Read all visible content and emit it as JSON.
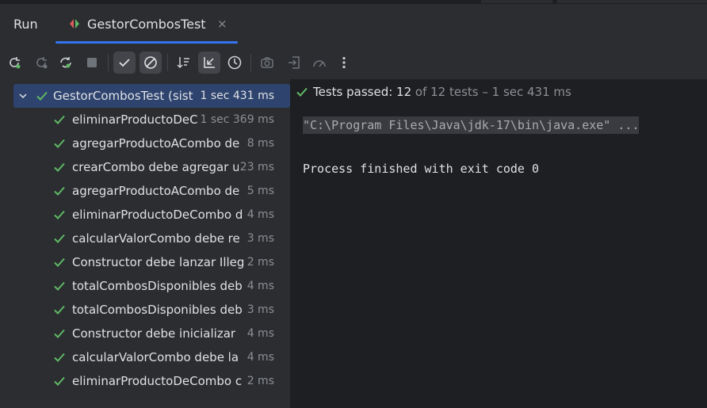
{
  "header": {
    "run_label": "Run",
    "tab_title": "GestorCombosTest",
    "tab_close": "×"
  },
  "toolbar": {
    "buttons": [
      {
        "icon": "rerun-icon",
        "active": false
      },
      {
        "icon": "rerun-failed-icon",
        "active": false
      },
      {
        "icon": "toggle-auto-test-icon",
        "active": false
      },
      {
        "icon": "stop-icon",
        "active": false
      },
      {
        "icon": "show-passed-icon",
        "active": true
      },
      {
        "icon": "show-ignored-icon",
        "active": true
      },
      {
        "icon": "sort-icon",
        "active": false
      },
      {
        "icon": "collapse-icon",
        "active": true
      },
      {
        "icon": "history-icon",
        "active": false
      },
      {
        "icon": "screenshot-icon",
        "active": false
      },
      {
        "icon": "import-tests-icon",
        "active": false
      },
      {
        "icon": "coverage-icon",
        "active": false
      },
      {
        "icon": "more-icon",
        "active": false
      }
    ]
  },
  "tree": {
    "root": {
      "label": "GestorCombosTest (sist",
      "duration": "1 sec 431 ms"
    },
    "items": [
      {
        "label": "eliminarProductoDeC",
        "duration": "1 sec 369 ms"
      },
      {
        "label": "agregarProductoACombo de",
        "duration": "8 ms"
      },
      {
        "label": "crearCombo debe agregar u",
        "duration": "23 ms"
      },
      {
        "label": "agregarProductoACombo de",
        "duration": "5 ms"
      },
      {
        "label": "eliminarProductoDeCombo d",
        "duration": "4 ms"
      },
      {
        "label": "calcularValorCombo debe re",
        "duration": "3 ms"
      },
      {
        "label": "Constructor debe lanzar Illeg",
        "duration": "2 ms"
      },
      {
        "label": "totalCombosDisponibles deb",
        "duration": "4 ms"
      },
      {
        "label": "totalCombosDisponibles deb",
        "duration": "3 ms"
      },
      {
        "label": "Constructor debe inicializar",
        "duration": "4 ms"
      },
      {
        "label": "calcularValorCombo debe la",
        "duration": "4 ms"
      },
      {
        "label": "eliminarProductoDeCombo c",
        "duration": "2 ms"
      }
    ]
  },
  "results": {
    "passed_label": "Tests passed: 12",
    "of_total": " of 12 tests – 1 sec 431 ms",
    "command": "\"C:\\Program Files\\Java\\jdk-17\\bin\\java.exe\" ...",
    "exit_message": "Process finished with exit code 0"
  },
  "colors": {
    "accent": "#3574f0",
    "pass_green": "#5fb865",
    "selection": "#2e436e"
  }
}
